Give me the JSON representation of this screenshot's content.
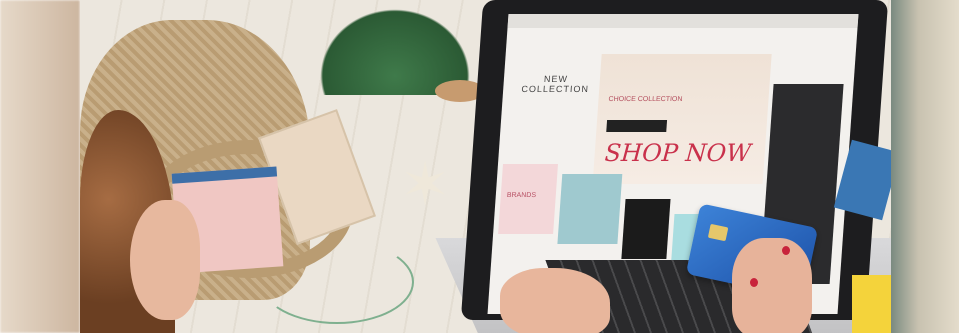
{
  "image": {
    "description_text": {
      "new_collection": "NEW COLLECTION",
      "shop_now": "SHOP NOW",
      "brands": "BRANDS",
      "banner_line": "CHOICE COLLECTION"
    }
  }
}
